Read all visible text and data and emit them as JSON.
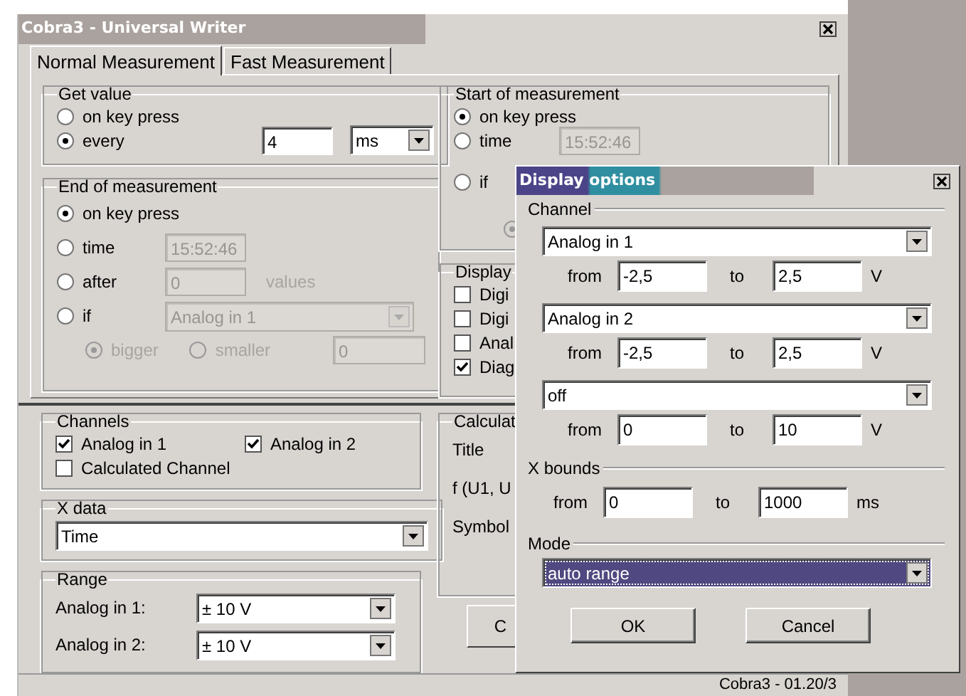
{
  "window": {
    "title": "Cobra3 - Universal Writer"
  },
  "tabs": [
    {
      "label": "Normal Measurement",
      "selected": true
    },
    {
      "label": "Fast Measurement",
      "selected": false
    }
  ],
  "get_value": {
    "title": "Get value",
    "options": [
      {
        "label": "on key press",
        "selected": false
      },
      {
        "label": "every",
        "selected": true
      }
    ],
    "interval": "4",
    "unit": "ms"
  },
  "end_of_measurement": {
    "title": "End of measurement",
    "options": [
      {
        "label": "on key press",
        "selected": true,
        "kind": "plain"
      },
      {
        "label": "time",
        "selected": false,
        "kind": "field",
        "value": "15:52:46",
        "disabled": true
      },
      {
        "label": "after",
        "selected": false,
        "kind": "field",
        "value": "0",
        "suffix": "values",
        "disabled": true
      },
      {
        "label": "if",
        "selected": false,
        "kind": "select",
        "value": "Analog in 1",
        "disabled": true
      }
    ],
    "compare": [
      {
        "label": "bigger",
        "selected": true,
        "disabled": true
      },
      {
        "label": "smaller",
        "selected": false,
        "disabled": true
      }
    ],
    "threshold": "0"
  },
  "start_of_measurement": {
    "title": "Start of measurement",
    "options": [
      {
        "label": "on key press",
        "selected": true,
        "kind": "plain"
      },
      {
        "label": "time",
        "selected": false,
        "kind": "field",
        "value": "15:52:46",
        "disabled": true
      },
      {
        "label": "if",
        "selected": false,
        "kind": "plain"
      }
    ],
    "compare": [
      {
        "selected": true,
        "disabled": true
      }
    ]
  },
  "display": {
    "title": "Display",
    "items": [
      {
        "label": "Digi",
        "checked": false
      },
      {
        "label": "Digi",
        "checked": false
      },
      {
        "label": "Anal",
        "checked": false
      },
      {
        "label": "Diag",
        "checked": true
      }
    ]
  },
  "channels": {
    "title": "Channels",
    "items": [
      {
        "label": "Analog in 1",
        "checked": true
      },
      {
        "label": "Analog in 2",
        "checked": true
      },
      {
        "label": "Calculated Channel",
        "checked": false
      }
    ]
  },
  "x_data": {
    "title": "X data",
    "value": "Time"
  },
  "range": {
    "title": "Range",
    "rows": [
      {
        "label": "Analog in 1:",
        "value": "± 10 V"
      },
      {
        "label": "Analog in 2:",
        "value": "± 10 V"
      }
    ]
  },
  "calculated": {
    "title": "Calculat",
    "labels": [
      "Title",
      "f (U1, U",
      "Symbol"
    ],
    "button": "C"
  },
  "status_bar": {
    "text": "Cobra3 - 01.20/3"
  },
  "dialog": {
    "title": "Display options",
    "channel_title": "Channel",
    "channels": [
      {
        "value": "Analog in 1",
        "from_label": "from",
        "from": "-2,5",
        "to_label": "to",
        "to": "2,5",
        "unit": "V"
      },
      {
        "value": "Analog in 2",
        "from_label": "from",
        "from": "-2,5",
        "to_label": "to",
        "to": "2,5",
        "unit": "V"
      },
      {
        "value": "off",
        "from_label": "from",
        "from": "0",
        "to_label": "to",
        "to": "10",
        "unit": "V"
      }
    ],
    "x_bounds": {
      "title": "X bounds",
      "from_label": "from",
      "from": "0",
      "to_label": "to",
      "to": "1000",
      "unit": "ms"
    },
    "mode": {
      "title": "Mode",
      "value": "auto range",
      "focused": true
    },
    "buttons": [
      "OK",
      "Cancel"
    ]
  }
}
